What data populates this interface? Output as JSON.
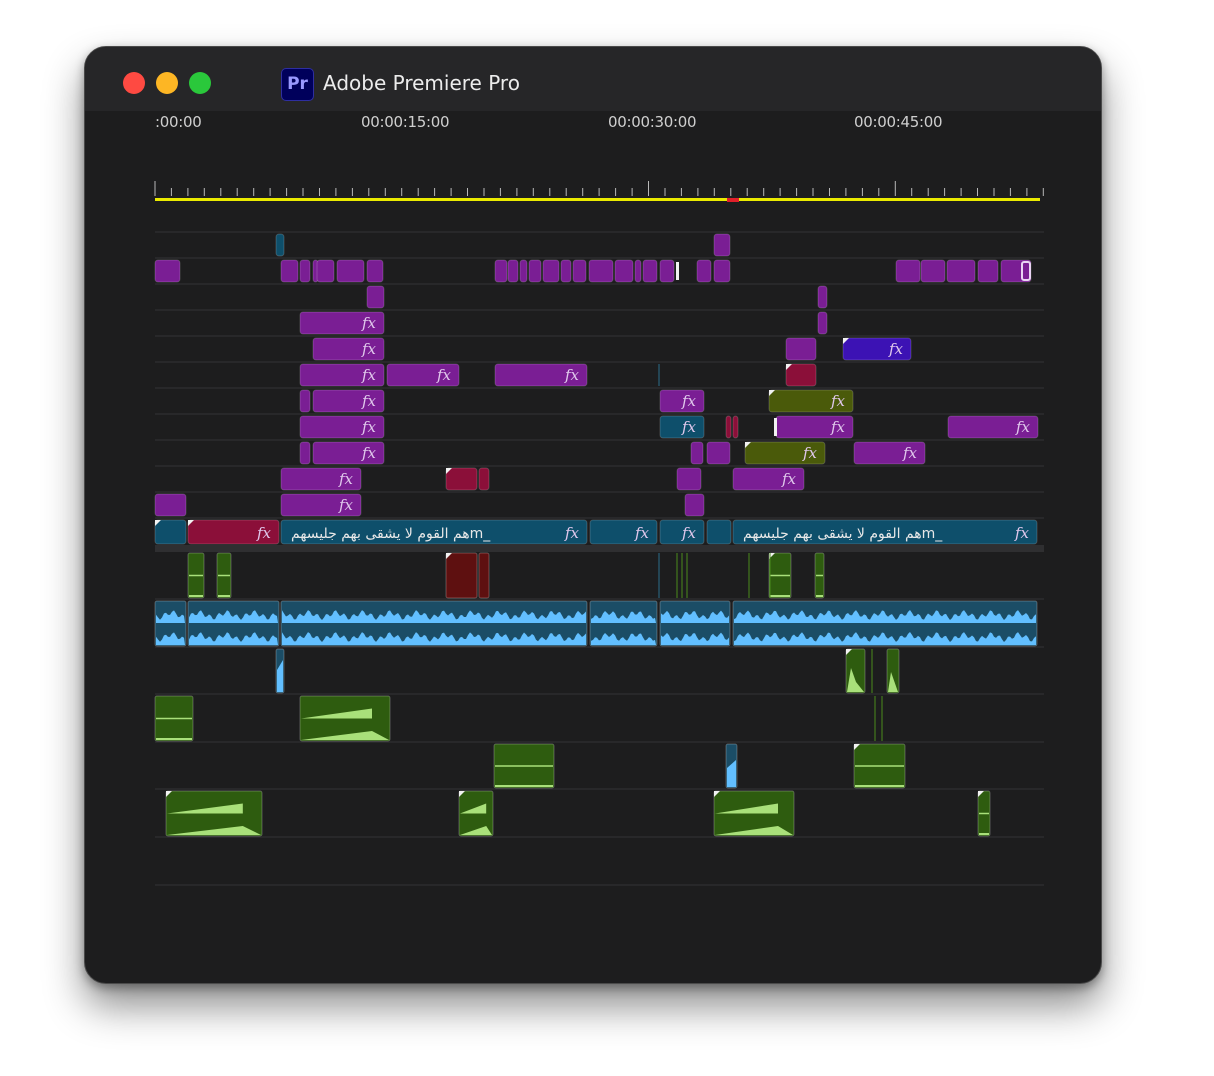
{
  "window": {
    "app_icon": "Pr",
    "title": "Adobe Premiere Pro",
    "controls": [
      "close-button",
      "minimize-button",
      "maximize-button"
    ]
  },
  "timeline": {
    "ruler_labels": [
      ":00:00",
      "00:00:15:00",
      "00:00:30:00",
      "00:00:45:00"
    ],
    "fx_label": "fx",
    "caption_text": "هم القوم لا يشقى بهم جليسهم",
    "caption_suffix": "m_"
  },
  "colors": {
    "background": "#1d1d1e",
    "video_clip": "#7a1e94",
    "video_clip_highlight": "#3c12b4",
    "red_clip": "#8b0f39",
    "olive_clip": "#4a5a0a",
    "teal_clip": "#0e4f6b",
    "audio_green": "#2e5c0f",
    "audio_blue": "#62bfff",
    "playhead_bar": "#eaea00",
    "in_point_marker": "#e0202a"
  }
}
